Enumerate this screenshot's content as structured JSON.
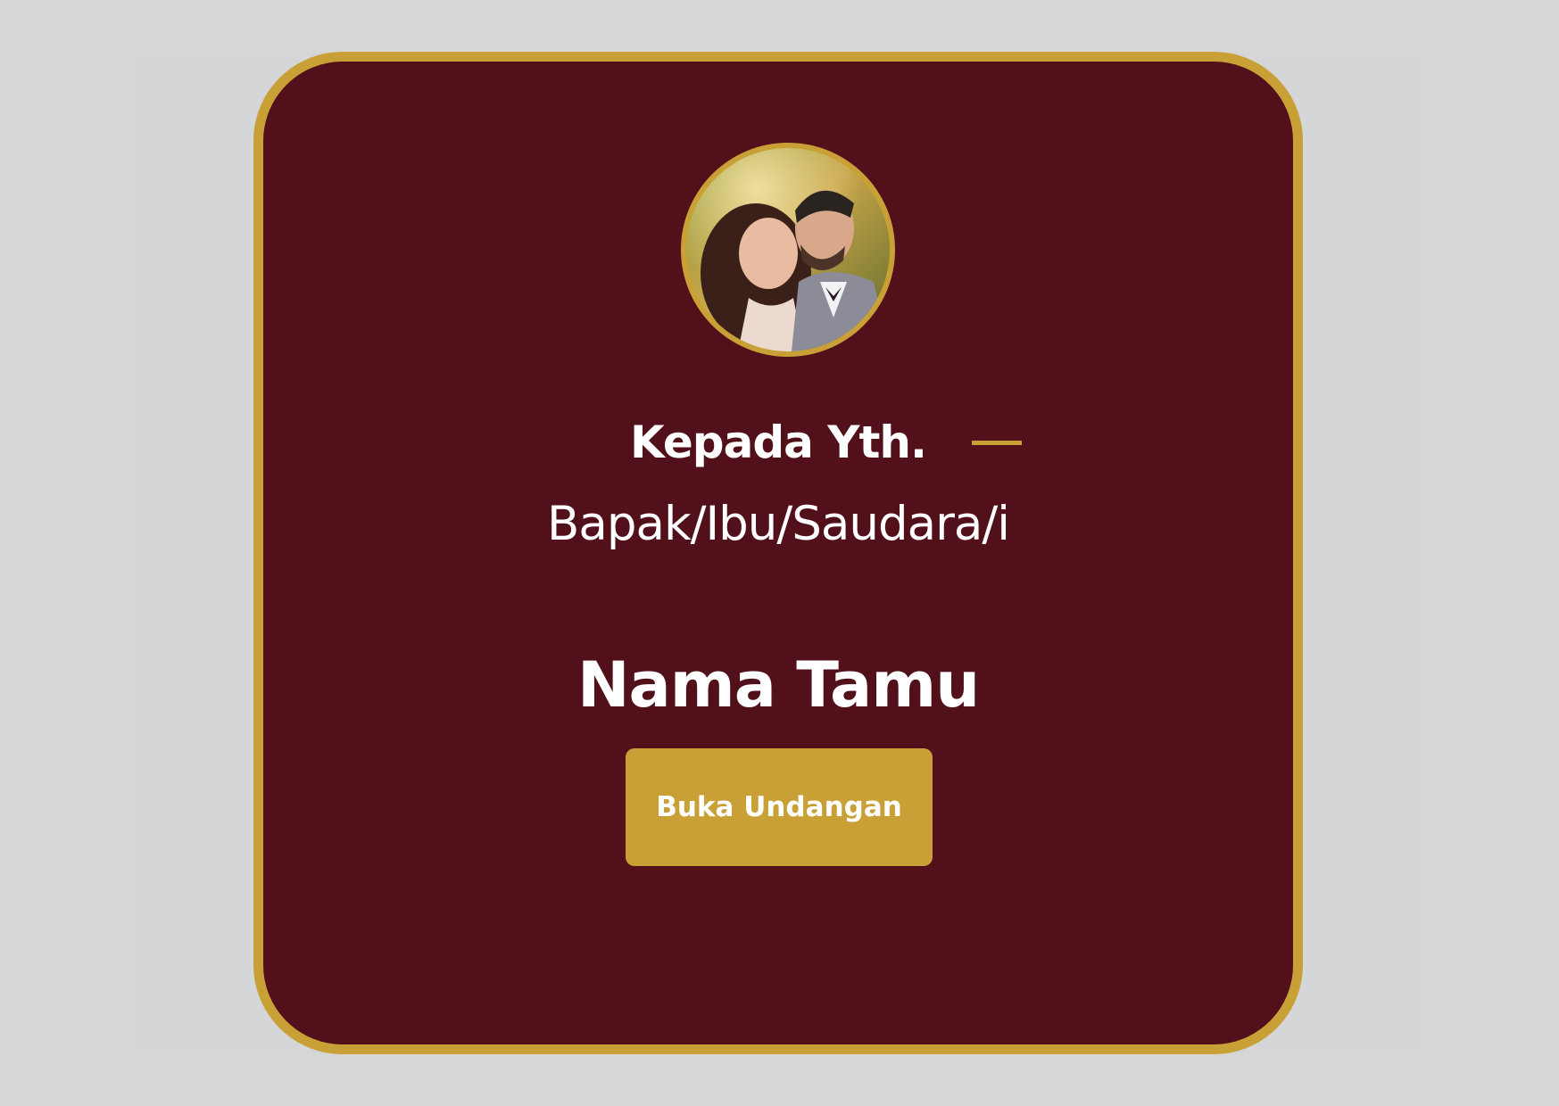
{
  "colors": {
    "page_background": "#d7d7d7",
    "card_background": "#52101a",
    "accent_gold": "#c9a036",
    "text": "#ffffff"
  },
  "invitation": {
    "photo": "couple-photo",
    "greeting": "Kepada Yth.",
    "salutation": "Bapak/Ibu/Saudara/i",
    "guest_name": "Nama Tamu",
    "open_button_label": "Buka Undangan"
  }
}
